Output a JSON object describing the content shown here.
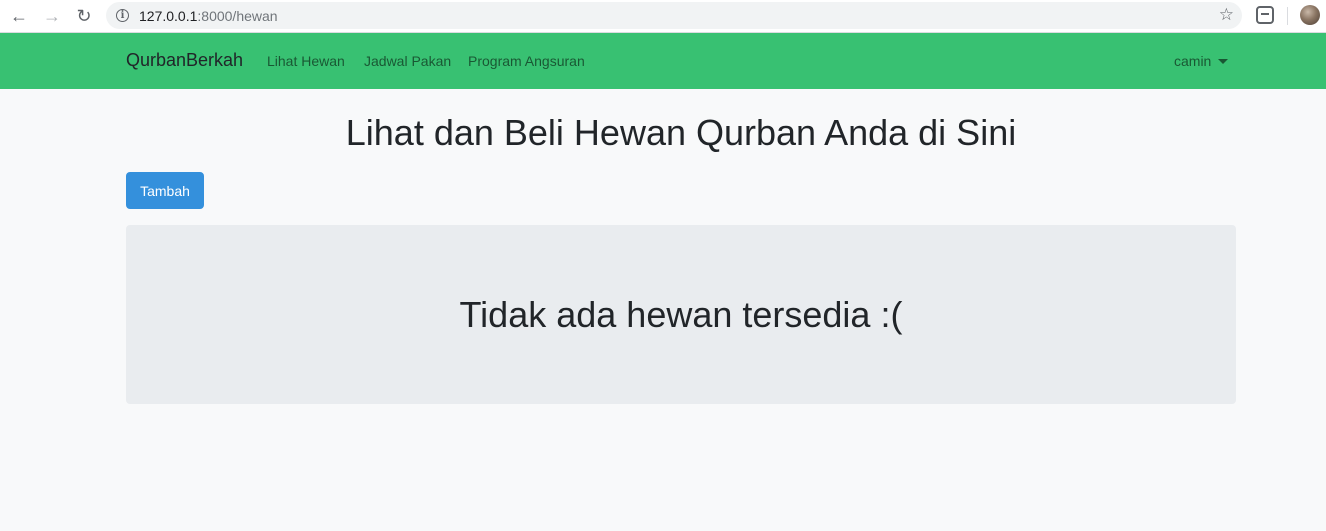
{
  "browser": {
    "url_host": "127.0.0.1",
    "url_path": ":8000/hewan"
  },
  "navbar": {
    "brand": "QurbanBerkah",
    "links": [
      "Lihat Hewan",
      "Jadwal Pakan",
      "Program Angsuran"
    ],
    "user": "camin",
    "color": "#38c172"
  },
  "main": {
    "title": "Lihat dan Beli Hewan Qurban Anda di Sini",
    "add_button": "Tambah",
    "empty_message": "Tidak ada hewan tersedia :("
  },
  "colors": {
    "primary_button": "#3490dc",
    "background": "#f8f9fa",
    "jumbotron": "#e9ecef"
  }
}
